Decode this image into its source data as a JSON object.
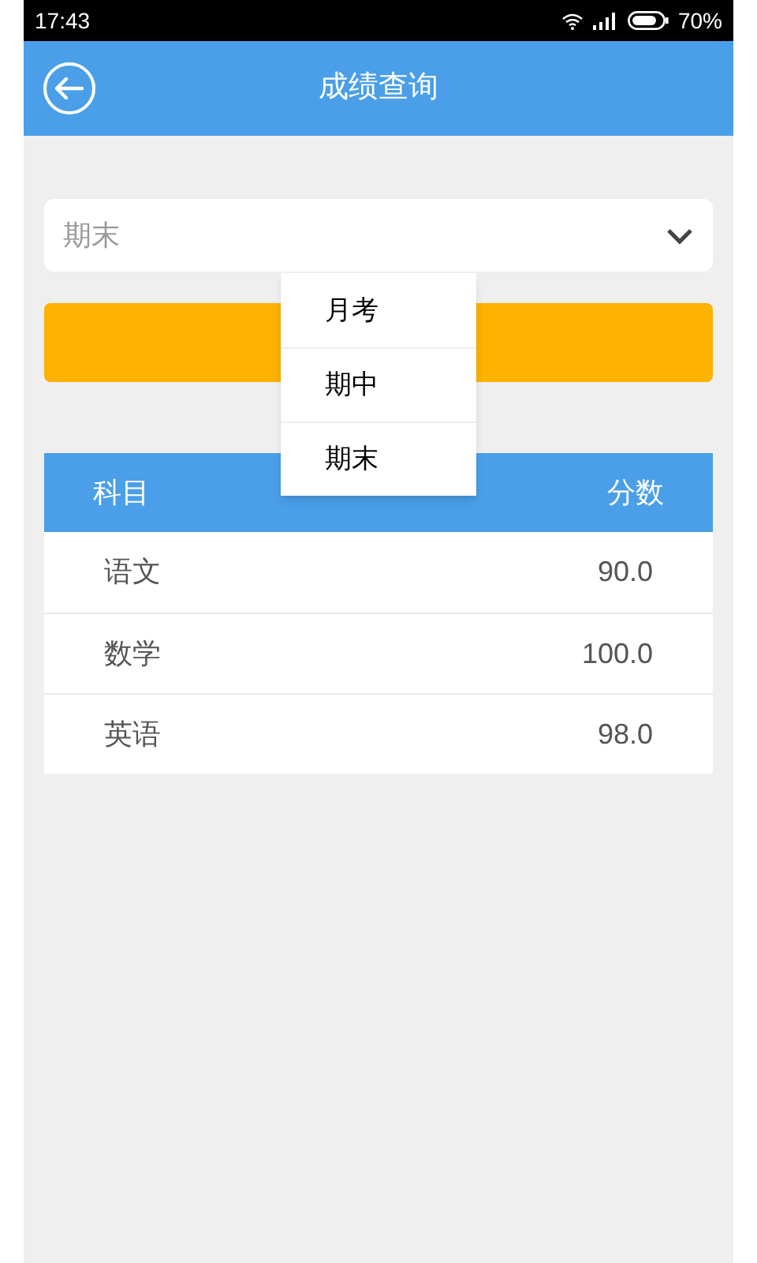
{
  "status_bar": {
    "time": "17:43",
    "battery": "70%"
  },
  "header": {
    "title": "成绩查询"
  },
  "exam_select": {
    "value": "期末",
    "expanded": true,
    "options": [
      {
        "label": "月考"
      },
      {
        "label": "期中"
      },
      {
        "label": "期末"
      }
    ]
  },
  "table": {
    "columns": [
      "科目",
      "分数"
    ],
    "rows": [
      [
        "语文",
        "90.0"
      ],
      [
        "数学",
        "100.0"
      ],
      [
        "英语",
        "98.0"
      ]
    ]
  }
}
